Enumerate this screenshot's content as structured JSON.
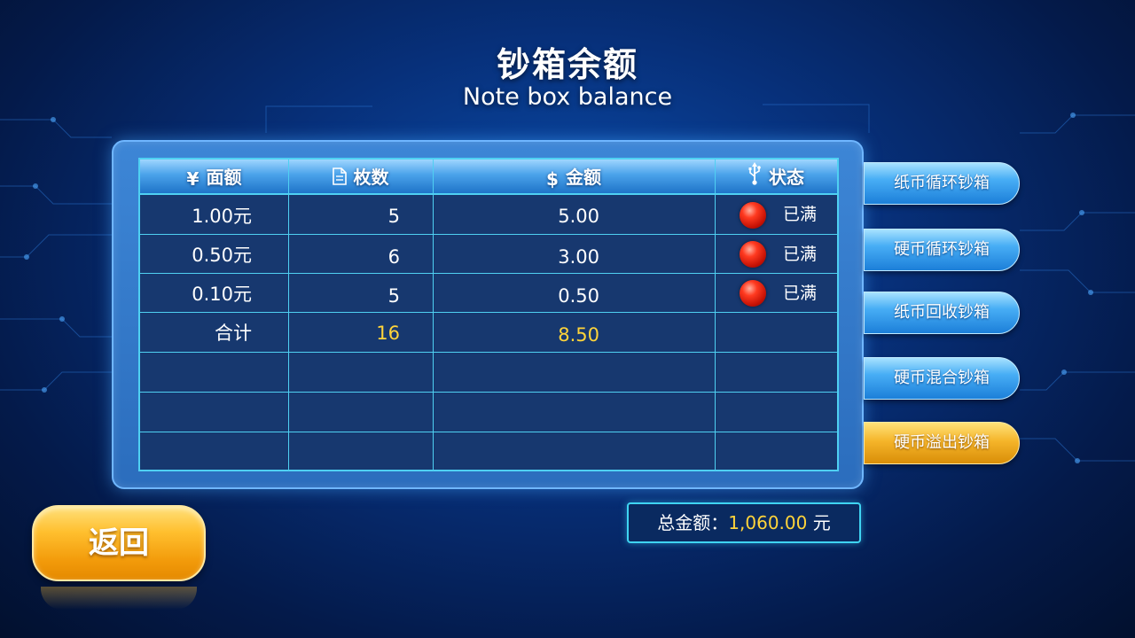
{
  "title": {
    "cn": "钞箱余额",
    "en": "Note box balance"
  },
  "table": {
    "headers": [
      {
        "icon": "yen-icon",
        "glyph": "¥",
        "label": "面额"
      },
      {
        "icon": "document-icon",
        "label": "枚数"
      },
      {
        "icon": "dollar-icon",
        "glyph": "$",
        "label": "金额"
      },
      {
        "icon": "usb-icon",
        "label": "状态"
      }
    ],
    "rows": [
      {
        "denomination": "1.00元",
        "count": "5",
        "amount": "5.00",
        "status": "已满"
      },
      {
        "denomination": "0.50元",
        "count": "6",
        "amount": "3.00",
        "status": "已满"
      },
      {
        "denomination": "0.10元",
        "count": "5",
        "amount": "0.50",
        "status": "已满"
      }
    ],
    "total": {
      "label": "合计",
      "count": "16",
      "amount": "8.50"
    }
  },
  "side_buttons": [
    {
      "label": "纸币循环钞箱",
      "color": "#48aef5"
    },
    {
      "label": "硬币循环钞箱",
      "color": "#48aef5"
    },
    {
      "label": "纸币回收钞箱",
      "color": "#48aef5"
    },
    {
      "label": "硬币混合钞箱",
      "color": "#48aef5"
    },
    {
      "label": "硬币溢出钞箱",
      "color": "#f5b52a"
    }
  ],
  "summary": {
    "label": "总金额：",
    "value": "1,060.00",
    "unit": "元"
  },
  "back_button": {
    "label": "返回"
  },
  "colors": {
    "accent_yellow": "#ffd43a",
    "status_red": "#e0200a",
    "grid_line": "#4fd0f2"
  }
}
